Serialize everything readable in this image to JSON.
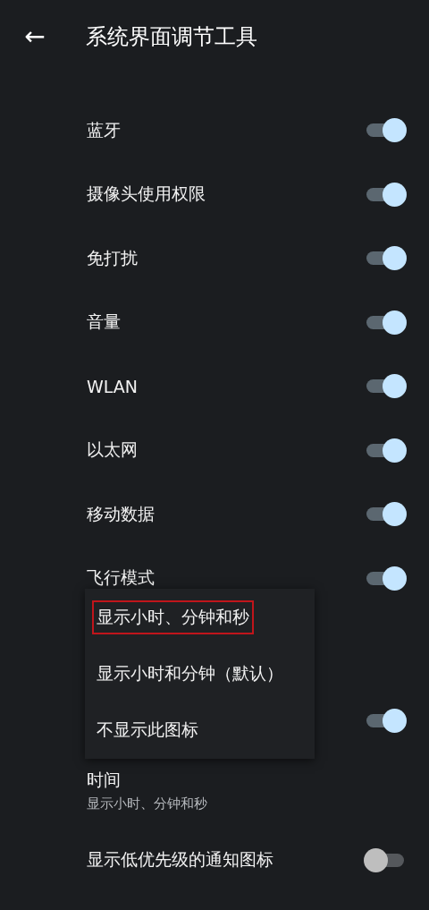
{
  "header": {
    "back": "←",
    "title": "系统界面调节工具"
  },
  "settings": [
    {
      "kind": "toggle",
      "label": "蓝牙",
      "on": true
    },
    {
      "kind": "toggle",
      "label": "摄像头使用权限",
      "on": true
    },
    {
      "kind": "toggle",
      "label": "免打扰",
      "on": true
    },
    {
      "kind": "toggle",
      "label": "音量",
      "on": true
    },
    {
      "kind": "toggle",
      "label": "WLAN",
      "on": true
    },
    {
      "kind": "toggle",
      "label": "以太网",
      "on": true
    },
    {
      "kind": "toggle",
      "label": "移动数据",
      "on": true
    },
    {
      "kind": "toggle",
      "label": "飞行模式",
      "on": true
    },
    {
      "kind": "gap"
    },
    {
      "kind": "toggle",
      "on": true
    },
    {
      "kind": "summary",
      "label": "时间",
      "summary": "显示小时、分钟和秒"
    },
    {
      "kind": "toggle",
      "label": "显示低优先级的通知图标",
      "on": false
    }
  ],
  "menu": {
    "items": [
      {
        "label": "显示小时、分钟和秒",
        "highlighted": true
      },
      {
        "label": "显示小时和分钟（默认）",
        "highlighted": false
      },
      {
        "label": "不显示此图标",
        "highlighted": false
      }
    ]
  }
}
